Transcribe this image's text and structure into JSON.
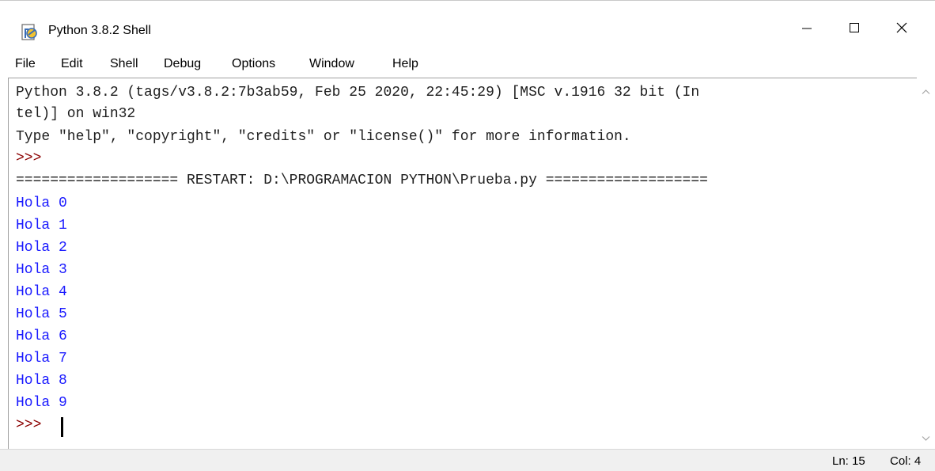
{
  "window": {
    "title": "Python 3.8.2 Shell"
  },
  "menu": {
    "items": [
      "File",
      "Edit",
      "Shell",
      "Debug",
      "Options",
      "Window",
      "Help"
    ]
  },
  "shell": {
    "lines": [
      {
        "text": "Python 3.8.2 (tags/v3.8.2:7b3ab59, Feb 25 2020, 22:45:29) [MSC v.1916 32 bit (In",
        "kind": "normal"
      },
      {
        "text": "tel)] on win32",
        "kind": "normal"
      },
      {
        "text": "Type \"help\", \"copyright\", \"credits\" or \"license()\" for more information.",
        "kind": "normal"
      },
      {
        "text": ">>>",
        "kind": "prompt"
      },
      {
        "text": "=================== RESTART: D:\\PROGRAMACION PYTHON\\Prueba.py ===================",
        "kind": "normal"
      },
      {
        "text": "Hola 0",
        "kind": "output"
      },
      {
        "text": "Hola 1",
        "kind": "output"
      },
      {
        "text": "Hola 2",
        "kind": "output"
      },
      {
        "text": "Hola 3",
        "kind": "output"
      },
      {
        "text": "Hola 4",
        "kind": "output"
      },
      {
        "text": "Hola 5",
        "kind": "output"
      },
      {
        "text": "Hola 6",
        "kind": "output"
      },
      {
        "text": "Hola 7",
        "kind": "output"
      },
      {
        "text": "Hola 8",
        "kind": "output"
      },
      {
        "text": "Hola 9",
        "kind": "output"
      },
      {
        "text": ">>>",
        "kind": "prompt"
      }
    ]
  },
  "status": {
    "line": "Ln: 15",
    "col": "Col: 4"
  },
  "colors": {
    "prompt": "#8b0000",
    "output": "#1a1aff",
    "text": "#1e1e1e"
  }
}
